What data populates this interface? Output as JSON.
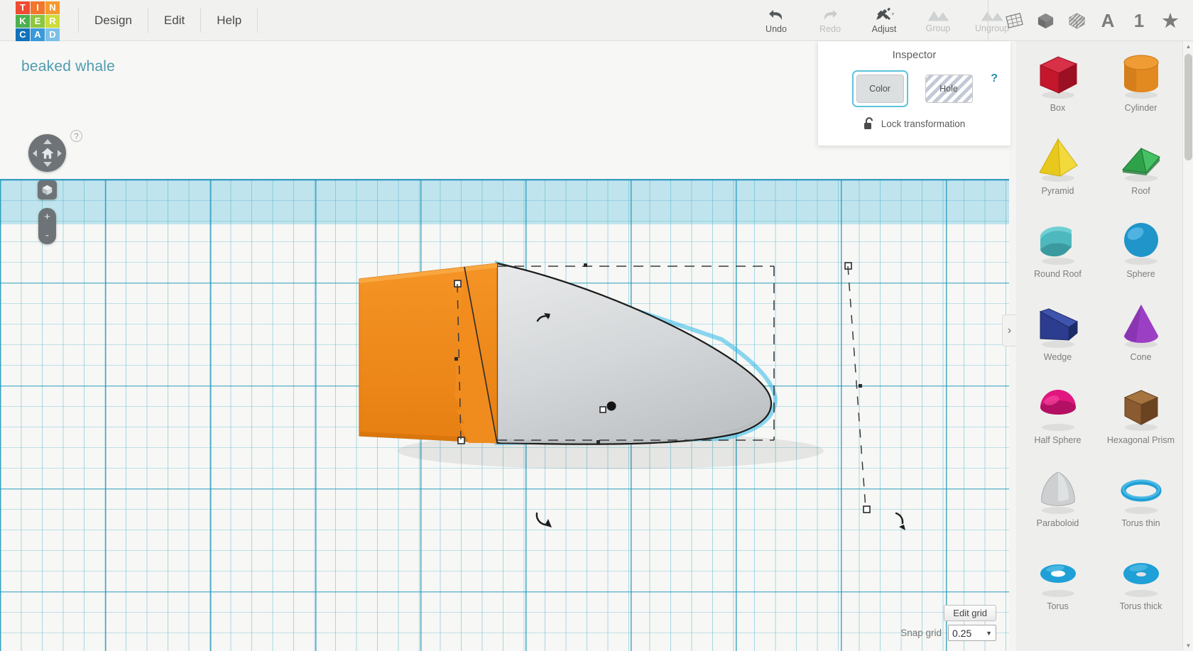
{
  "app": {
    "logo_letters": [
      {
        "ch": "T",
        "color": "#ef4a32"
      },
      {
        "ch": "I",
        "color": "#f2762b"
      },
      {
        "ch": "N",
        "color": "#f59a2c"
      },
      {
        "ch": "K",
        "color": "#4cb050"
      },
      {
        "ch": "E",
        "color": "#8dc63f"
      },
      {
        "ch": "R",
        "color": "#cddc39"
      },
      {
        "ch": "C",
        "color": "#1272bb"
      },
      {
        "ch": "A",
        "color": "#3a9ad9"
      },
      {
        "ch": "D",
        "color": "#7cc0e8"
      }
    ],
    "menu": [
      "Design",
      "Edit",
      "Help"
    ]
  },
  "toolbar": {
    "items": [
      {
        "label": "Undo",
        "icon": "undo-arrow-icon",
        "enabled": true
      },
      {
        "label": "Redo",
        "icon": "redo-arrow-icon",
        "enabled": false
      },
      {
        "label": "Adjust",
        "icon": "adjust-tools-icon",
        "enabled": true,
        "has_dropdown": true
      },
      {
        "label": "Group",
        "icon": "group-shapes-icon",
        "enabled": false
      },
      {
        "label": "Ungroup",
        "icon": "ungroup-shapes-icon",
        "enabled": false
      }
    ],
    "right_icons": [
      {
        "name": "workplane-icon",
        "glyph": ""
      },
      {
        "name": "solid-box-icon",
        "glyph": ""
      },
      {
        "name": "hole-box-icon",
        "glyph": ""
      },
      {
        "name": "text-tool-icon",
        "glyph": "A"
      },
      {
        "name": "number-tool-icon",
        "glyph": "1"
      },
      {
        "name": "favorites-star-icon",
        "glyph": "★"
      }
    ]
  },
  "canvas": {
    "project_title": "beaked whale",
    "nav": {
      "home_icon": "home-icon",
      "fit_icon": "fit-view-cube-icon",
      "zoom_in": "+",
      "zoom_out": "-",
      "help": "?"
    },
    "grid_controls": {
      "edit_grid_label": "Edit grid",
      "snap_grid_label": "Snap grid",
      "snap_grid_value": "0.25"
    },
    "colors": {
      "workplane_band": "#aadcea",
      "grid_line": "#38aac8",
      "selected_outline": "#30b9e8",
      "shape_orange": "#f28b22",
      "shape_gray": "#cfd2d4"
    }
  },
  "inspector": {
    "title": "Inspector",
    "color_label": "Color",
    "hole_label": "Hole",
    "selected_mode": "Color",
    "lock_label": "Lock transformation",
    "lock_icon": "unlocked-padlock-icon",
    "help_label": "?"
  },
  "shapes_panel": {
    "collapse_icon": "›",
    "items": [
      {
        "label": "Box",
        "kind": "box",
        "color": "#c4172b",
        "color2": "#9c1023",
        "color3": "#d83046"
      },
      {
        "label": "Cylinder",
        "kind": "cylinder",
        "color": "#e2891f",
        "color2": "#c97617",
        "color3": "#ee9c33"
      },
      {
        "label": "Pyramid",
        "kind": "pyramid",
        "color": "#e8c81c",
        "color2": "#cdae12",
        "color3": "#f2d93c"
      },
      {
        "label": "Roof",
        "kind": "roof",
        "color": "#2fa149",
        "color2": "#1f7a36",
        "color3": "#45c163"
      },
      {
        "label": "Round Roof",
        "kind": "roundroof",
        "color": "#4db8bd",
        "color2": "#3a9aa0",
        "color3": "#6fd0d4"
      },
      {
        "label": "Sphere",
        "kind": "sphere",
        "color": "#2095c9",
        "color2": "#1377a8",
        "color3": "#5ebde8"
      },
      {
        "label": "Wedge",
        "kind": "wedge",
        "color": "#2c3d8f",
        "color2": "#1d2a68",
        "color3": "#3f54ad"
      },
      {
        "label": "Cone",
        "kind": "cone",
        "color": "#9b3fc4",
        "color2": "#7a2ba0",
        "color3": "#b566dc"
      },
      {
        "label": "Half Sphere",
        "kind": "halfsphere",
        "color": "#e0177f",
        "color2": "#b30f63",
        "color3": "#f6459f"
      },
      {
        "label": "Hexagonal Prism",
        "kind": "hexprism",
        "color": "#8a5a30",
        "color2": "#6b4321",
        "color3": "#a5743f"
      },
      {
        "label": "Paraboloid",
        "kind": "paraboloid",
        "color": "#cdcfd0",
        "color2": "#a9abac",
        "color3": "#e7e9ea"
      },
      {
        "label": "Torus thin",
        "kind": "torusthin",
        "color": "#1fa0d6",
        "color2": "#1581ae",
        "color3": "#5fc2e8"
      },
      {
        "label": "Torus",
        "kind": "torus",
        "color": "#1fa0d6",
        "color2": "#1581ae",
        "color3": "#5fc2e8"
      },
      {
        "label": "Torus thick",
        "kind": "torusthick",
        "color": "#1fa0d6",
        "color2": "#1581ae",
        "color3": "#5fc2e8"
      }
    ]
  }
}
